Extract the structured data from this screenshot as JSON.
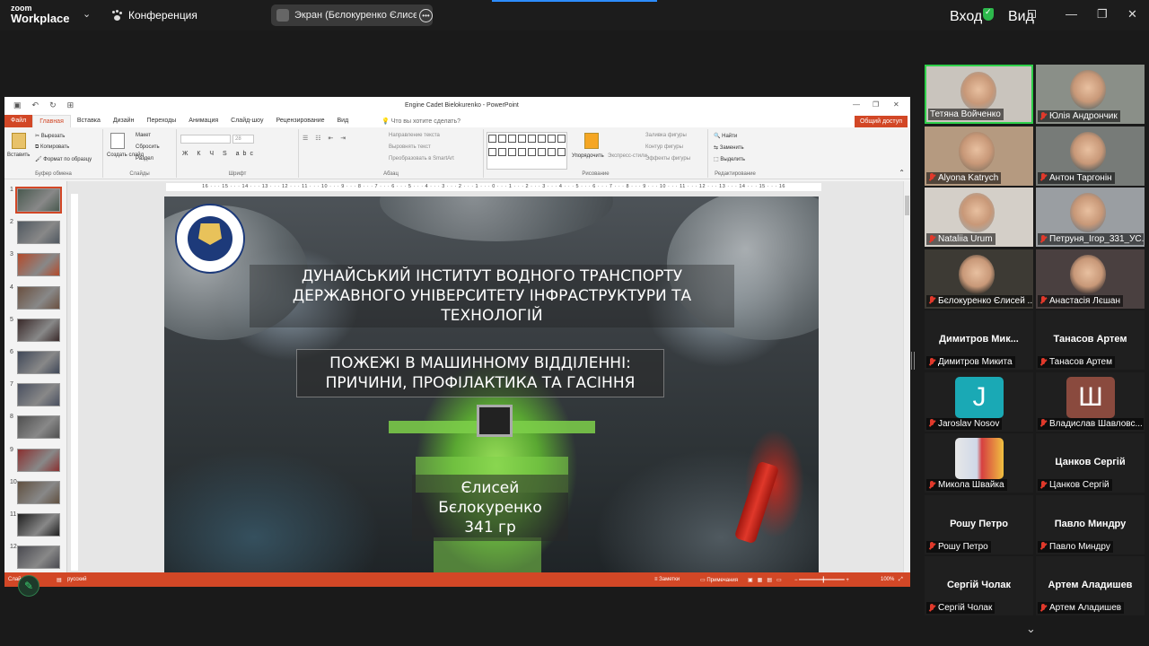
{
  "zoom": {
    "logo_top": "zoom",
    "logo_bottom": "Workplace",
    "meeting_label": "Конференция",
    "screen_share_label": "Экран (Бєлокуренко Єлисей Ми",
    "login": "Вход",
    "view": "Вид"
  },
  "ppt": {
    "window_title": "Engine Cadet Bielokurenko - PowerPoint",
    "tabs": [
      "Файл",
      "Главная",
      "Вставка",
      "Дизайн",
      "Переходы",
      "Анимация",
      "Слайд-шоу",
      "Рецензирование",
      "Вид"
    ],
    "tell_me": "Что вы хотите сделать?",
    "share": "Общий доступ",
    "ribbon": {
      "clipboard": {
        "paste": "Вставить",
        "cut": "Вырезать",
        "copy": "Копировать",
        "format": "Формат по образцу",
        "group": "Буфер обмена"
      },
      "slides": {
        "new": "Создать слайд",
        "layout": "Макет",
        "reset": "Сбросить",
        "section": "Раздел",
        "group": "Слайды"
      },
      "font": {
        "size": "28",
        "group": "Шрифт"
      },
      "paragraph": {
        "direction": "Направление текста",
        "align": "Выровнять текст",
        "smartart": "Преобразовать в SmartArt",
        "group": "Абзац"
      },
      "drawing": {
        "arrange": "Упорядочить",
        "styles": "Экспресс-стили",
        "fill": "Заливка фигуры",
        "outline": "Контур фигуры",
        "effects": "Эффекты фигуры",
        "group": "Рисование"
      },
      "editing": {
        "find": "Найти",
        "replace": "Заменить",
        "select": "Выделить",
        "group": "Редактирование"
      }
    },
    "ruler": "16 · · · 15 · · · 14 · · · 13 · · · 12 · · · 11 · · · 10 · · · 9 · · · 8 · · · 7 · · · 6 · · · 5 · · · 4 · · · 3 · · · 2 · · · 1 · · · 0 · · · 1 · · · 2 · · · 3 · · · 4 · · · 5 · · · 6 · · · 7 · · · 8 · · · 9 · · · 10 · · · 11 · · · 12 · · · 13 · · · 14 · · · 15 · · · 16",
    "slide_numbers": [
      "1",
      "2",
      "3",
      "4",
      "5",
      "6",
      "7",
      "8",
      "9",
      "10",
      "11",
      "12"
    ],
    "slide": {
      "title": "ДУНАЙСЬКИЙ ІНСТИТУТ ВОДНОГО ТРАНСПОРТУ ДЕРЖАВНОГО УНІВЕРСИТЕТУ ІНФРАСТРУКТУРИ ТА ТЕХНОЛОГІЙ",
      "subtitle": "ПОЖЕЖІ В МАШИННОМУ ВІДДІЛЕННІ: ПРИЧИНИ, ПРОФІЛАКТИКА ТА ГАСІННЯ",
      "author": "Єлисей Бєлокуренко",
      "group": "341 гр"
    },
    "status": {
      "slide_info": "Слайд",
      "language": "русский",
      "notes": "Заметки",
      "comments": "Примечания",
      "zoom": "100%"
    }
  },
  "participants": [
    {
      "name": "Тетяна Войченко",
      "muted": false,
      "video": true,
      "speaking": true,
      "bg": "#c9c4bd"
    },
    {
      "name": "Юлія Андрончик",
      "muted": true,
      "video": true,
      "speaking": false,
      "bg": "#8a8f88"
    },
    {
      "name": "Alyona Katrych",
      "muted": true,
      "video": true,
      "speaking": false,
      "bg": "#b59a80"
    },
    {
      "name": "Антон Таргонін",
      "muted": true,
      "video": true,
      "speaking": false,
      "bg": "#777b78"
    },
    {
      "name": "Nataliia Urum",
      "muted": true,
      "video": true,
      "speaking": false,
      "bg": "#d4cfc8"
    },
    {
      "name": "Петруня_Ігор_331_УС...",
      "muted": true,
      "video": true,
      "speaking": false,
      "bg": "#9a9ea2"
    },
    {
      "name": "Бєлокуренко Єлисей ...",
      "muted": true,
      "video": true,
      "speaking": false,
      "bg": "#3d3a34"
    },
    {
      "name": "Анастасія Лєшан",
      "muted": true,
      "video": true,
      "speaking": false,
      "bg": "#4a4040"
    },
    {
      "name": "Димитров Микита",
      "muted": true,
      "video": false,
      "display": "Димитров  Мик...",
      "bg": "#1f1f1f"
    },
    {
      "name": "Танасов Артем",
      "muted": true,
      "video": false,
      "display": "Танасов Артем",
      "bg": "#1f1f1f"
    },
    {
      "name": "Jaroslav Nosov",
      "muted": true,
      "video": false,
      "avatar": "J",
      "avatar_bg": "#1aa9b5",
      "bg": "#1f1f1f"
    },
    {
      "name": "Владислав Шавловс...",
      "muted": true,
      "video": false,
      "avatar": "Ш",
      "avatar_bg": "#8a4a3e",
      "bg": "#1f1f1f"
    },
    {
      "name": "Микола Швайка",
      "muted": true,
      "video": false,
      "picture": true,
      "bg": "#1f1f1f"
    },
    {
      "name": "Цанков Сергій",
      "muted": true,
      "video": false,
      "display": "Цанков Сергій",
      "bg": "#1f1f1f"
    },
    {
      "name": "Рошу Петро",
      "muted": true,
      "video": false,
      "display": "Рошу Петро",
      "bg": "#1f1f1f"
    },
    {
      "name": "Павло Миндру",
      "muted": true,
      "video": false,
      "display": "Павло Миндру",
      "bg": "#1f1f1f"
    },
    {
      "name": "Сергій Чолак",
      "muted": true,
      "video": false,
      "display": "Сергій Чолак",
      "bg": "#1f1f1f"
    },
    {
      "name": "Артем Аладишев",
      "muted": true,
      "video": false,
      "display": "Артем Аладишев",
      "bg": "#1f1f1f"
    }
  ],
  "colors": {
    "ppt_accent": "#d24726",
    "zoom_bg": "#1a1a1a",
    "speaking": "#2fd04a",
    "muted": "#e0392b"
  }
}
